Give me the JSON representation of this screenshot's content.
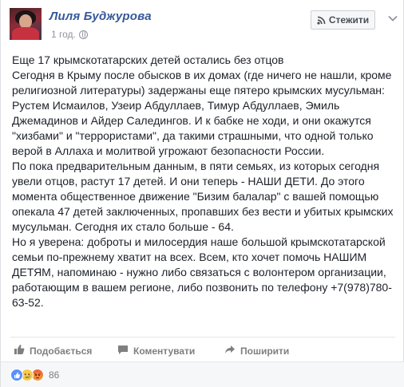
{
  "post": {
    "author": "Лиля Буджурова",
    "time": "1 год.",
    "follow_label": "Стежити",
    "paragraphs": [
      "Еще 17 крымскотатарских детей остались без отцов",
      "Сегодня в Крыму после обысков в их домах (где ничего не нашли, кроме религиозной литературы) задержаны еще пятеро крымских мусульман: Рустем Исмаилов, Узеир Абдуллаев, Тимур Абдуллаев, Эмиль Джемадинов и Айдер Саледингов. И к бабке не ходи, и они окажутся \"хизбами\" и \"террористами\", да такими страшными, что одной только верой в Аллаха и молитвой угрожают безопасности России.",
      "По пока предварительным данным, в пяти семьях, из которых сегодня увели отцов, растут 17 детей. И они теперь - НАШИ ДЕТИ. До этого момента общественное движение \"Бизим балалар\" с вашей помощью опекала 47 детей заключенных, пропавших без вести и убитых крымских мусульман. Сегодня их стало больше - 64.",
      "Но я уверена: доброты и милосердия наше большой крымскотатарской семьи по-прежнему хватит на всех. Всем, кто хочет помочь НАШИМ ДЕТЯМ, напоминаю - нужно либо связаться с волонтером организации, работающим в вашем регионе, либо позвонить по телефону +7(978)780-63-52."
    ]
  },
  "actions": {
    "like": "Подобається",
    "comment": "Коментувати",
    "share": "Поширити"
  },
  "reactions": {
    "count": "86",
    "types": [
      "like",
      "sad",
      "angry"
    ]
  },
  "colors": {
    "link": "#365899",
    "muted": "#90949c",
    "action": "#7f7f7f"
  }
}
